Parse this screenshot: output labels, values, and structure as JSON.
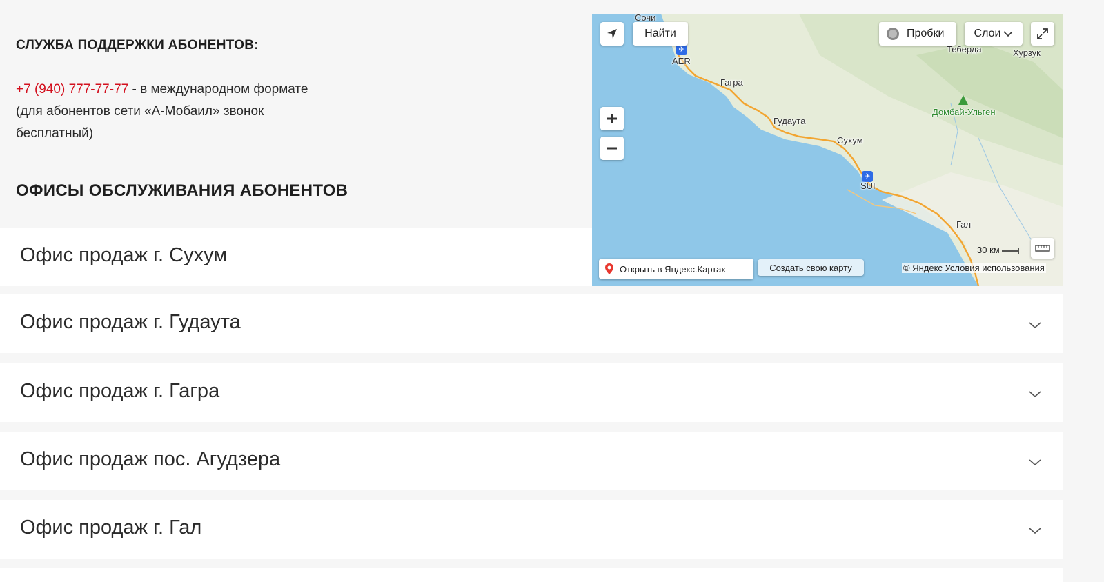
{
  "support": {
    "title": "СЛУЖБА ПОДДЕРЖКИ АБОНЕНТОВ:",
    "phone": "+7 (940) 777-77-77",
    "phone_suffix": " - в международном формате",
    "note_line1": "(для абонентов сети «А-Мобаил» звонок",
    "note_line2": "бесплатный)"
  },
  "offices": {
    "title": "ОФИСЫ ОБСЛУЖИВАНИЯ АБОНЕНТОВ",
    "items": [
      {
        "label": "Офис продаж г. Сухум"
      },
      {
        "label": "Офис продаж г. Гудаута"
      },
      {
        "label": "Офис продаж г. Гагра"
      },
      {
        "label": "Офис продаж пос. Агудзера"
      },
      {
        "label": "Офис продаж г. Гал"
      }
    ]
  },
  "map": {
    "find_label": "Найти",
    "traffic_label": "Пробки",
    "layers_label": "Слои",
    "open_yandex": "Открыть в Яндекс.Картах",
    "create_map": "Создать свою карту",
    "copyright": "© Яндекс",
    "terms": "Условия использования",
    "scale": "30 км",
    "places": {
      "sochi": "Сочи",
      "aer": "AER",
      "gagra": "Гагра",
      "gudauta": "Гудаута",
      "sukhum": "Сухум",
      "sui": "SUI",
      "gal": "Гал",
      "teberda": "Теберда",
      "khurzuk": "Хурзук",
      "dombay": "Домбай-Ульген"
    },
    "colors": {
      "sea": "#8fc7e8",
      "land": "#e9eee0",
      "road": "#f2a531",
      "airport": "#2e6be6"
    }
  }
}
